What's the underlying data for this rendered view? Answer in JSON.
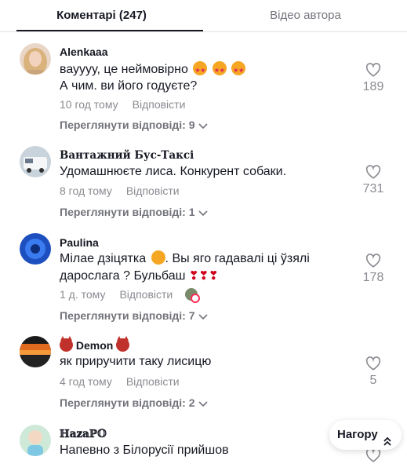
{
  "tabs": [
    {
      "label": "Коментарі (247)",
      "active": true
    },
    {
      "label": "Відео автора",
      "active": false
    }
  ],
  "comments": [
    {
      "username": "Alenkaaa",
      "lines": [
        "вауууу, це неймовірно",
        "А чим. ви його годуєте?"
      ],
      "time": "10 год тому",
      "reply_label": "Відповісти",
      "view_replies": "Переглянути відповіді: 9",
      "likes": "189",
      "avatar_icon": "avatar-blonde-woman"
    },
    {
      "username": "Вантажний Бус-Таксі",
      "lines": [
        "Удомашнюєте лиса. Конкурент собаки."
      ],
      "time": "8 год тому",
      "reply_label": "Відповісти",
      "view_replies": "Переглянути відповіді: 1",
      "likes": "731",
      "avatar_icon": "avatar-van"
    },
    {
      "username": "Paulina",
      "lines": [
        "Мілае дзіцятка",
        ". Вы яго гадавалі ці ўзялі",
        "дарослага ? Бульбаш"
      ],
      "time": "1 д. тому",
      "reply_label": "Відповісти",
      "view_replies": "Переглянути відповіді: 7",
      "likes": "178",
      "avatar_icon": "avatar-blue-flower"
    },
    {
      "username": "Demon",
      "lines": [
        "як приручити таку лисицю"
      ],
      "time": "4 год тому",
      "reply_label": "Відповісти",
      "view_replies": "Переглянути відповіді: 2",
      "likes": "5",
      "avatar_icon": "avatar-sunset"
    },
    {
      "username": "ℍ𝕒𝕫𝕒ℙ𝕆",
      "lines": [
        "Напевно з Білорусії прийшов"
      ],
      "time": "",
      "reply_label": "",
      "view_replies": "",
      "likes": "",
      "avatar_icon": "avatar-child-cartoon"
    }
  ],
  "back_to_top": "Нагору",
  "colors": {
    "text": "#161823",
    "muted": "#8a8b91",
    "accent": "#fe2c55"
  }
}
